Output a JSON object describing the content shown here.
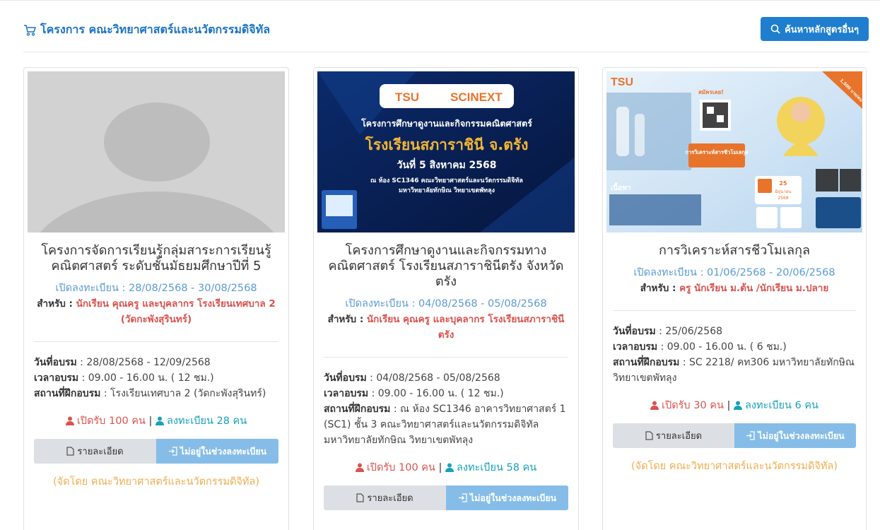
{
  "header": {
    "title": "โครงการ คณะวิทยาศาสตร์และนวัตกรรมดิจิทัล",
    "search_button": "ค้นหาหลักสูตรอื่นๆ"
  },
  "common": {
    "reg_prefix": "เปิดลงทะเบียน : ",
    "for_label": "สำหรับ : ",
    "train_date_label": "วันที่อบรม",
    "train_time_label": "เวลาอบรม",
    "place_label": "สถานที่ฝึกอบรม",
    "detail_button": "รายละเอียด",
    "register_button": "ไม่อยู่ในช่วงลงทะเบียน"
  },
  "poster2": {
    "brand_left": "TSU",
    "brand_right": "SCINEXT",
    "line1": "โครงการศึกษาดูงานและกิจกรรมคณิตศาสตร์",
    "line2": "โรงเรียนสภาราชินี จ.ตรัง",
    "line3": "วันที่ 5 สิงหาคม 2568",
    "line4": "ณ ห้อง SC1346 คณะวิทยาศาสตร์และนวัตกรรมดิจิทัล",
    "line5": "มหาวิทยาลัยทักษิณ วิทยาเขตพัทลุง"
  },
  "poster3": {
    "brand": "TSU",
    "tag": "สมัครเลย!",
    "badge": "การวิเคราะห์สารชีวโมเลกุล",
    "price": "1,500 บาท/คน",
    "content_label": "เนื้อหา",
    "date_day": "25",
    "date_month": "มิถุนายน",
    "date_year": "2568"
  },
  "cards": [
    {
      "title": "โครงการจัดการเรียนรู้กลุ่มสาระการเรียนรู้คณิตศาสตร์ ระดับชั้นมัธยมศึกษาปีที่ 5",
      "reg_period": "28/08/2568 - 30/08/2568",
      "for": "นักเรียน คุณครู และบุคลากร โรงเรียนเทศบาล 2 (วัดกะพังสุรินทร์)",
      "train_date": "28/08/2568 - 12/09/2568",
      "train_time": "09.00 - 16.00 น. ( 12 ชม.)",
      "place": "โรงเรียนเทศบาล 2 (วัดกะพังสุรินทร์)",
      "open_text": "เปิดรับ 100 คน",
      "registered_text": "ลงทะเบียน 28 คน",
      "org": "(จัดโดย คณะวิทยาศาสตร์และนวัตกรรมดิจิทัล)"
    },
    {
      "title": "โครงการศึกษาดูงานและกิจกรรมทางคณิตศาสตร์ โรงเรียนสภาราชินีตรัง จังหวัดตรัง",
      "reg_period": "04/08/2568 - 05/08/2568",
      "for": "นักเรียน คุณครู และบุคลากร โรงเรียนสภาราชินีตรัง",
      "train_date": "04/08/2568 - 05/08/2568",
      "train_time": "09.00 - 16.00 น. ( 12 ชม.)",
      "place": "ณ ห้อง SC1346 อาคารวิทยาศาสตร์ 1 (SC1) ชั้น 3 คณะวิทยาศาสตร์และนวัตกรรมดิจิทัล มหาวิทยาลัยทักษิณ วิทยาเขตพัทลุง",
      "open_text": "เปิดรับ 100 คน",
      "registered_text": "ลงทะเบียน 58 คน",
      "org": ""
    },
    {
      "title": "การวิเคราะห์สารชีวโมเลกุล",
      "reg_period": "01/06/2568 - 20/06/2568",
      "for": "ครู นักเรียน ม.ต้น /นักเรียน ม.ปลาย",
      "train_date": "25/06/2568",
      "train_time": "09.00 - 16.00 น. ( 6 ชม.)",
      "place": "SC 2218/ คท306 มหาวิทยาลัยทักษิณ วิทยาเขตพัทลุง",
      "open_text": "เปิดรับ 30 คน",
      "registered_text": "ลงทะเบียน 6 คน",
      "org": "(จัดโดย คณะวิทยาศาสตร์และนวัตกรรมดิจิทัล)"
    }
  ]
}
